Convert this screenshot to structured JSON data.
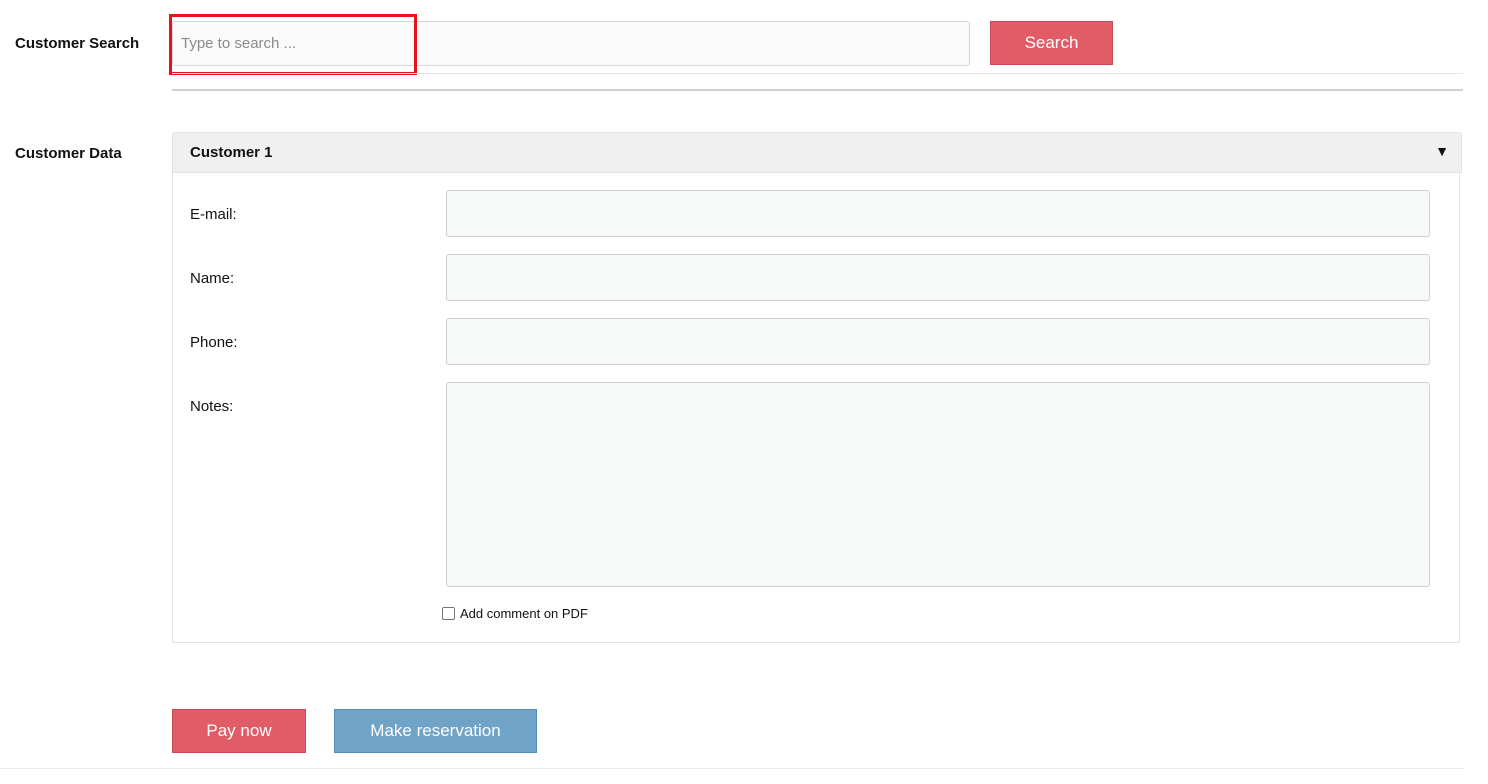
{
  "search": {
    "label": "Customer Search",
    "placeholder": "Type to search ...",
    "value": "",
    "button_label": "Search"
  },
  "customer_data": {
    "label": "Customer Data",
    "accordion": {
      "title": "Customer 1",
      "toggle_icon": "triangle-down",
      "toggle_glyph": "▼",
      "expanded": true
    },
    "fields": {
      "email": {
        "label": "E-mail:",
        "value": ""
      },
      "name": {
        "label": "Name:",
        "value": ""
      },
      "phone": {
        "label": "Phone:",
        "value": ""
      },
      "notes": {
        "label": "Notes:",
        "value": ""
      }
    },
    "pdf_comment": {
      "label": "Add comment on PDF",
      "checked": false
    }
  },
  "actions": {
    "pay_label": "Pay now",
    "reserve_label": "Make reservation"
  },
  "colors": {
    "primary_red": "#e05d68",
    "primary_blue": "#70a3c8",
    "highlight_red": "#e5131d"
  }
}
